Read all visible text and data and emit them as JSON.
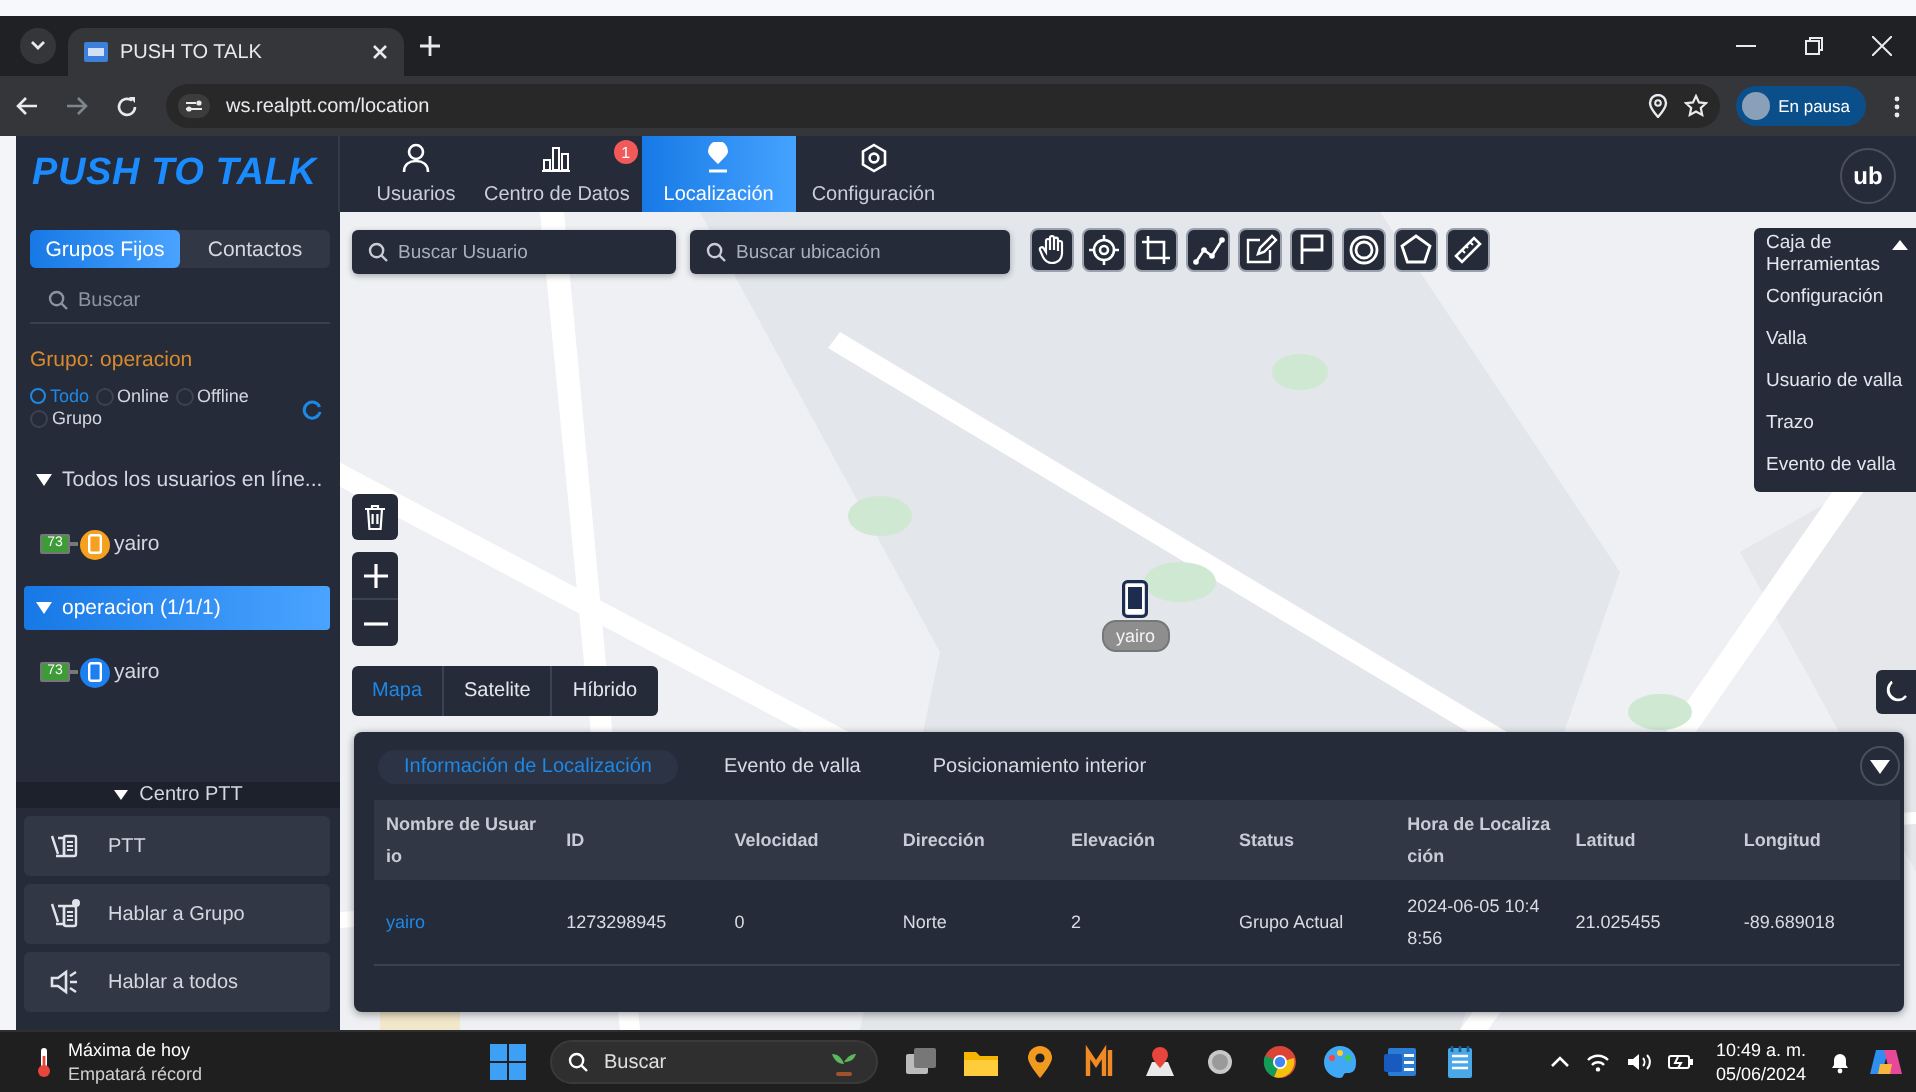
{
  "browser": {
    "tab_title": "PUSH TO TALK",
    "url": "ws.realptt.com/location",
    "profile": "En pausa"
  },
  "header": {
    "logo": "PUSH TO TALK",
    "nav": [
      {
        "label": "Usuarios",
        "selected": false,
        "kind": "users"
      },
      {
        "label": "Centro de Datos",
        "selected": false,
        "kind": "data",
        "badge": "1"
      },
      {
        "label": "Localización",
        "selected": true,
        "kind": "location"
      },
      {
        "label": "Configuración",
        "selected": false,
        "kind": "settings"
      }
    ],
    "avatar": "ub"
  },
  "sidebar": {
    "tabs": [
      {
        "label": "Grupos Fijos",
        "selected": true
      },
      {
        "label": "Contactos",
        "selected": false
      }
    ],
    "search": {
      "placeholder": "Buscar"
    },
    "group_label": "Grupo: operacion",
    "filters": [
      {
        "label": "Todo",
        "selected": true
      },
      {
        "label": "Online",
        "selected": false
      },
      {
        "label": "Offline",
        "selected": false
      },
      {
        "label": "Grupo",
        "selected": false
      }
    ],
    "tree": [
      {
        "label": "Todos los usuarios en líne...",
        "expanded": true,
        "selected": false,
        "children": [
          {
            "name": "yairo",
            "battery": "73",
            "color": "#f5a01e"
          }
        ]
      },
      {
        "label": "operacion (1/1/1)",
        "expanded": true,
        "selected": true,
        "children": [
          {
            "name": "yairo",
            "battery": "73",
            "color": "#1e7ff0"
          }
        ]
      }
    ],
    "ptt_center": {
      "title": "Centro PTT",
      "expanded": true,
      "buttons": [
        {
          "label": "PTT",
          "kind": "ptt"
        },
        {
          "label": "Hablar a Grupo",
          "kind": "group"
        },
        {
          "label": "Hablar a todos",
          "kind": "all"
        }
      ]
    }
  },
  "map": {
    "user_search": {
      "placeholder": "Buscar Usuario"
    },
    "location_search": {
      "placeholder": "Buscar ubicación"
    },
    "toolbox": {
      "title": "Caja de Herramientas",
      "expanded": true,
      "items": [
        "Configuración",
        "Valla",
        "Usuario de valla",
        "Trazo",
        "Evento de valla"
      ]
    },
    "map_types": [
      {
        "label": "Mapa",
        "selected": true
      },
      {
        "label": "Satelite",
        "selected": false
      },
      {
        "label": "Híbrido",
        "selected": false
      }
    ],
    "marker": {
      "label": "yairo"
    }
  },
  "panel": {
    "tabs": [
      {
        "label": "Información de Localización",
        "selected": true
      },
      {
        "label": "Evento de valla",
        "selected": false
      },
      {
        "label": "Posicionamiento interior",
        "selected": false
      }
    ],
    "table": {
      "columns": [
        "Nombre de Usuario",
        "ID",
        "Velocidad",
        "Dirección",
        "Elevación",
        "Status",
        "Hora de Localización",
        "Latitud",
        "Longitud"
      ],
      "rows": [
        [
          "yairo",
          "1273298945",
          "0",
          "Norte",
          "2",
          "Grupo Actual",
          "2024-06-05 10:48:56",
          "21.025455",
          "-89.689018"
        ]
      ]
    }
  },
  "taskbar": {
    "weather_title": "Máxima de hoy",
    "weather_subtitle": "Empatará récord",
    "search": {
      "placeholder": "Buscar"
    },
    "time": "10:49 a. m.",
    "date": "05/06/2024"
  }
}
